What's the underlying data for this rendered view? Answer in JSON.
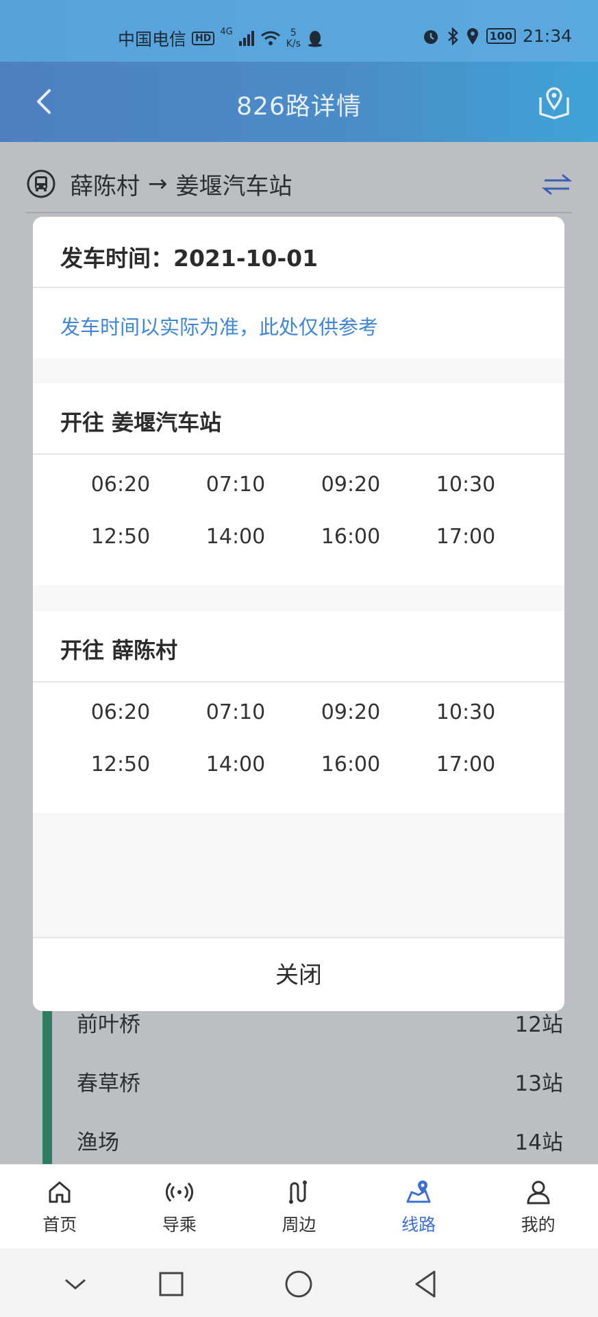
{
  "status_bar": {
    "carrier": "中国电信",
    "hd": "HD",
    "network": "4G",
    "speed_value": "5",
    "speed_unit": "K/s",
    "battery": "100",
    "time": "21:34"
  },
  "header": {
    "title": "826路详情",
    "back_icon": "chevron-left-icon",
    "map_icon": "map-pin-icon"
  },
  "route": {
    "from": "薛陈村",
    "arrow": "→",
    "to": "姜堰汽车站",
    "swap_icon": "swap-icon"
  },
  "stops": [
    {
      "name": "前叶桥",
      "count": "12站"
    },
    {
      "name": "春草桥",
      "count": "13站"
    },
    {
      "name": "渔场",
      "count": "14站"
    }
  ],
  "modal": {
    "title": "发车时间：2021-10-01",
    "note": "发车时间以实际为准，此处仅供参考",
    "directions": [
      {
        "label": "开往 姜堰汽车站",
        "times": [
          "06:20",
          "07:10",
          "09:20",
          "10:30",
          "12:50",
          "14:00",
          "16:00",
          "17:00"
        ]
      },
      {
        "label": "开往 薛陈村",
        "times": [
          "06:20",
          "07:10",
          "09:20",
          "10:30",
          "12:50",
          "14:00",
          "16:00",
          "17:00"
        ]
      }
    ],
    "close_label": "关闭"
  },
  "bottom_nav": [
    {
      "label": "首页",
      "icon": "home-icon"
    },
    {
      "label": "导乘",
      "icon": "broadcast-icon"
    },
    {
      "label": "周边",
      "icon": "route-icon"
    },
    {
      "label": "线路",
      "icon": "map-route-icon",
      "active": true
    },
    {
      "label": "我的",
      "icon": "user-icon"
    }
  ],
  "colors": {
    "accent": "#3b6fd4",
    "note_blue": "#3f86d6",
    "line_green": "#2c9a6a"
  }
}
